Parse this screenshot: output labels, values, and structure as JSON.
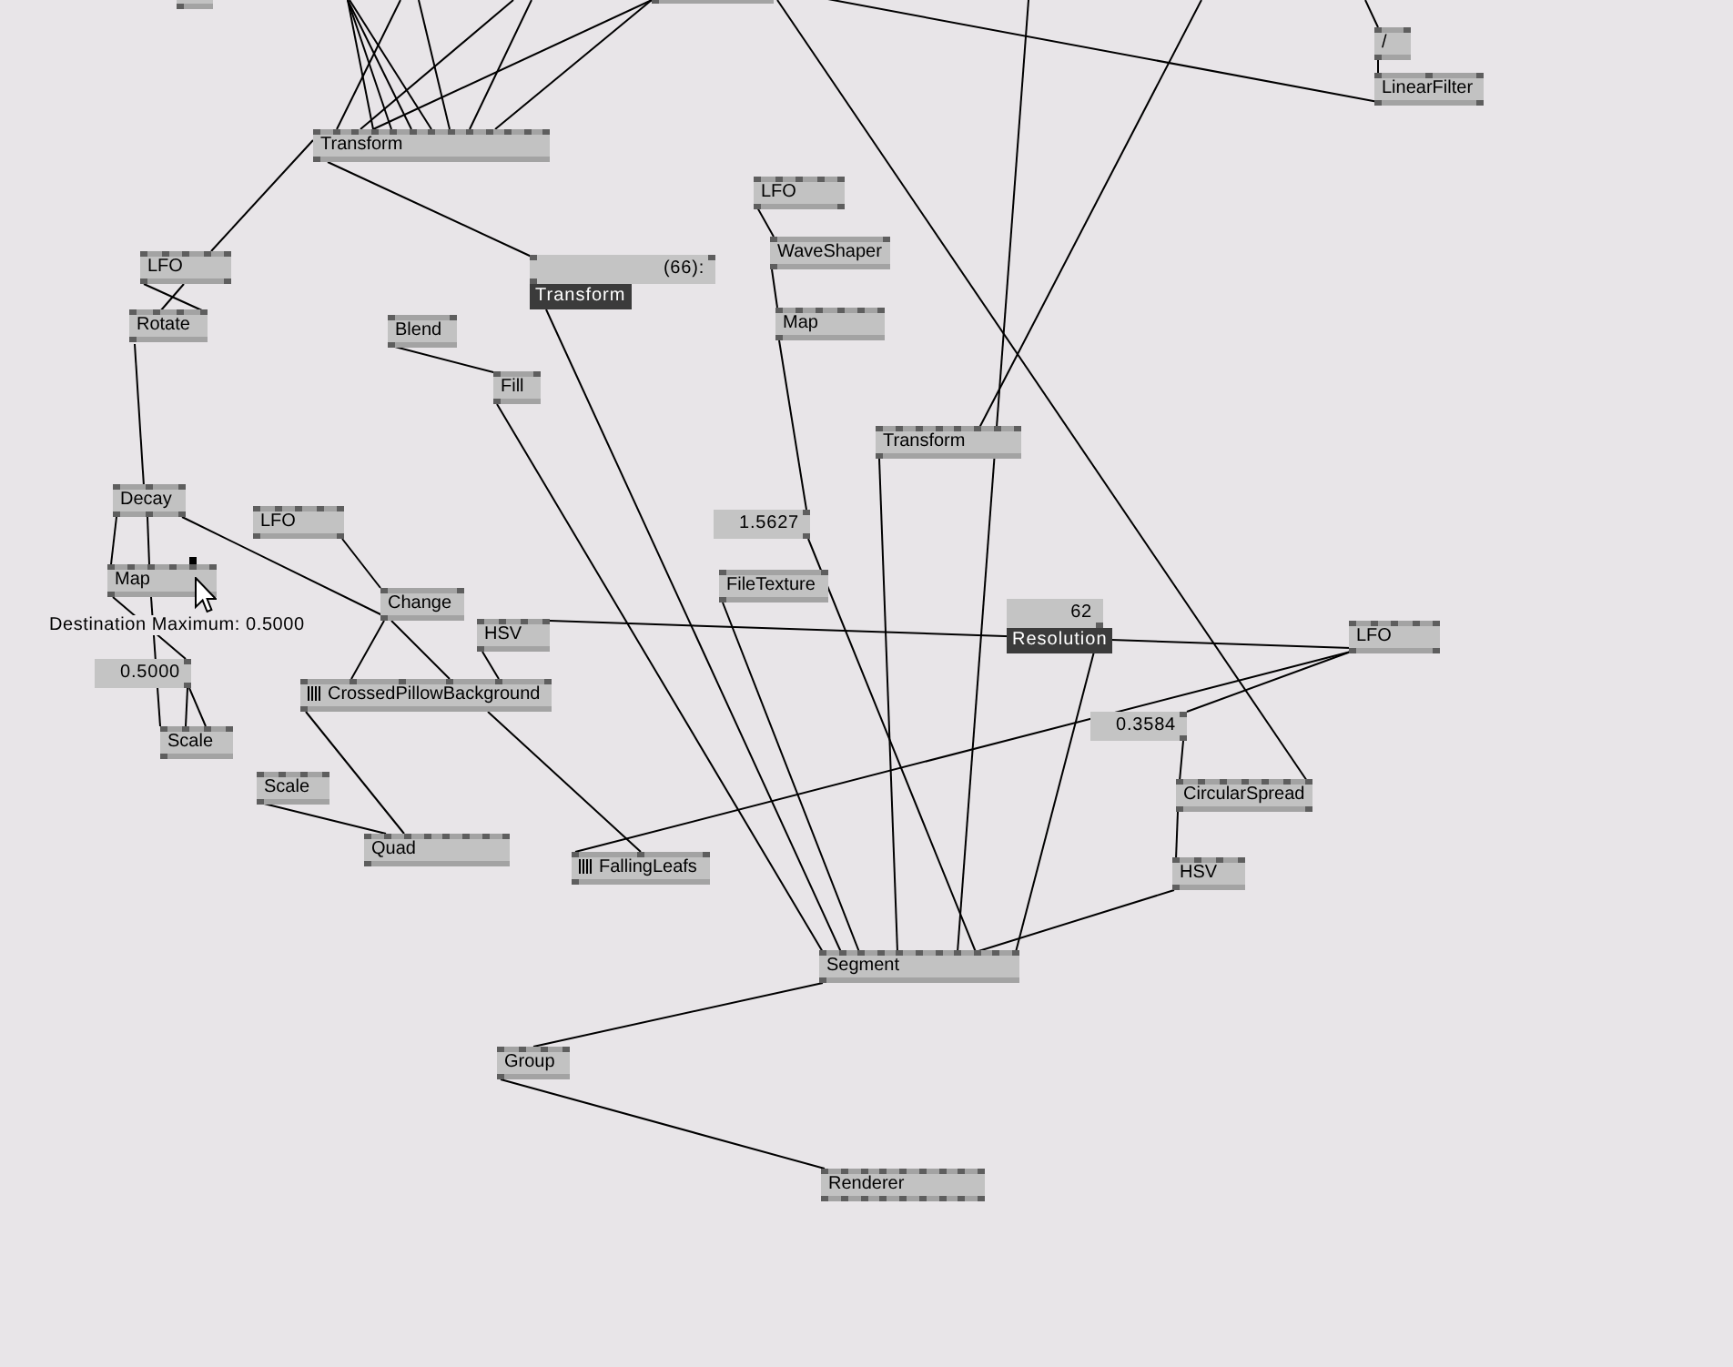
{
  "canvas": {
    "nodes": [
      {
        "kind": "clipped",
        "hovered": false
      },
      {
        "kind": "clipped",
        "hovered": false
      },
      {
        "kind": "node",
        "label": "/",
        "hovered": false
      },
      {
        "kind": "node",
        "label": "LinearFilter",
        "hovered": false
      },
      {
        "kind": "node",
        "label": "Transform",
        "hovered": false
      },
      {
        "kind": "node",
        "label": "LFO",
        "hovered": false
      },
      {
        "kind": "node",
        "label": "LFO",
        "hovered": false
      },
      {
        "kind": "inspector",
        "value": "(66):",
        "name": "Transform",
        "hovered": false
      },
      {
        "kind": "node",
        "label": "WaveShaper",
        "hovered": false
      },
      {
        "kind": "node",
        "label": "Rotate",
        "hovered": false
      },
      {
        "kind": "node",
        "label": "Blend",
        "hovered": false
      },
      {
        "kind": "node",
        "label": "Map",
        "hovered": false
      },
      {
        "kind": "node",
        "label": "Fill",
        "hovered": false
      },
      {
        "kind": "node",
        "label": "Transform",
        "hovered": false
      },
      {
        "kind": "node",
        "label": "Decay",
        "hovered": false
      },
      {
        "kind": "node",
        "label": "LFO",
        "hovered": false
      },
      {
        "kind": "iobox",
        "value": "1.5627",
        "hovered": false
      },
      {
        "kind": "node",
        "label": "Map",
        "hovered": true
      },
      {
        "kind": "node",
        "label": "Change",
        "hovered": false
      },
      {
        "kind": "node",
        "label": "FileTexture",
        "hovered": false
      },
      {
        "kind": "node",
        "label": "HSV",
        "hovered": false
      },
      {
        "kind": "inspector",
        "value": "62",
        "name": "Resolution",
        "hovered": false
      },
      {
        "kind": "node",
        "label": "LFO",
        "hovered": false
      },
      {
        "kind": "iobox",
        "value": "0.5000",
        "hovered": false
      },
      {
        "kind": "module",
        "label": "CrossedPillowBackground",
        "hovered": false
      },
      {
        "kind": "node",
        "label": "Scale",
        "hovered": false
      },
      {
        "kind": "iobox",
        "value": "0.3584",
        "hovered": false
      },
      {
        "kind": "node",
        "label": "Scale",
        "hovered": false
      },
      {
        "kind": "node",
        "label": "CircularSpread",
        "hovered": false
      },
      {
        "kind": "node",
        "label": "Quad",
        "hovered": false
      },
      {
        "kind": "module",
        "label": "FallingLeafs",
        "hovered": false
      },
      {
        "kind": "node",
        "label": "HSV",
        "hovered": false
      },
      {
        "kind": "node",
        "label": "Segment",
        "hovered": false
      },
      {
        "kind": "node",
        "label": "Group",
        "hovered": false
      },
      {
        "kind": "node",
        "label": "Renderer",
        "hovered": false
      }
    ],
    "tooltip": "Destination Maximum: 0.5000"
  }
}
